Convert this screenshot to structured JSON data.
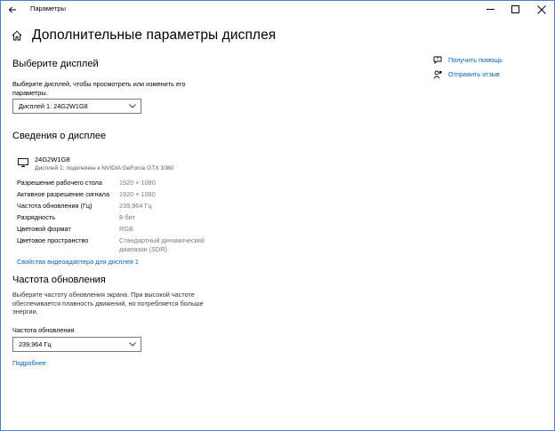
{
  "window": {
    "title": "Параметры",
    "minimize_icon": "minimize-icon",
    "maximize_icon": "maximize-icon",
    "close_icon": "close-icon"
  },
  "header": {
    "title": "Дополнительные параметры дисплея",
    "home_icon": "home-icon",
    "back_icon": "back-arrow-icon"
  },
  "select_display": {
    "heading": "Выберите дисплей",
    "description_line1": "Выберите дисплей, чтобы просмотреть или изменить его",
    "description_line2": "параметры.",
    "selected": "Дисплей 1: 24G2W1G8"
  },
  "display_info": {
    "heading": "Сведения о дисплее",
    "name": "24G2W1G8",
    "subtitle": "Дисплей 1: подключен к NVIDIA GeForce GTX 1080",
    "rows": [
      {
        "label": "Разрешение рабочего стола",
        "value": "1920 × 1080"
      },
      {
        "label": "Активное разрешение сигнала",
        "value": "1920 × 1080"
      },
      {
        "label": "Частота обновления (Гц)",
        "value": "239,964 Гц"
      },
      {
        "label": "Разрядность",
        "value": "8-бит"
      },
      {
        "label": "Цветовой формат",
        "value": "RGB"
      },
      {
        "label": "Цветовое пространство",
        "value_line1": "Стандартный динамический",
        "value_line2": "диапазон (SDR)"
      }
    ],
    "adapter_link": "Свойства видеоадаптера для дисплея 1"
  },
  "refresh_rate": {
    "heading": "Частота обновления",
    "description_line1": "Выберите частоту обновления экрана. При высокой частоте",
    "description_line2": "обеспечивается плавность движений, но потребляется больше",
    "description_line3": "энергии.",
    "field_label": "Частота обновления",
    "selected": "239,964 Гц",
    "more_link": "Подробнее"
  },
  "side_links": {
    "help": "Получить помощь",
    "feedback": "Отправить отзыв"
  },
  "colors": {
    "accent": "#0063b1",
    "muted_text": "#7a7a7a"
  }
}
